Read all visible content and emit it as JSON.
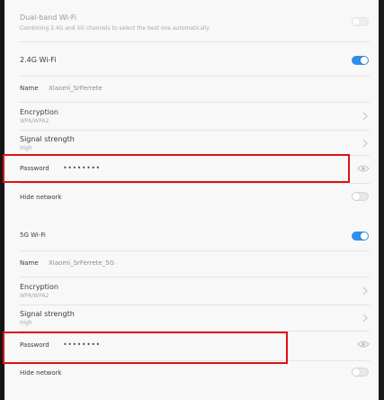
{
  "dual_band": {
    "title": "Dual-band Wi-Fi",
    "subtitle": "Combining 2.4G and 5G channels to select the best one automatically",
    "enabled": false
  },
  "band_24": {
    "title": "2.4G Wi-Fi",
    "enabled": true,
    "name_label": "Name",
    "name_value": "Xiaomi_SrFerrete",
    "encryption_label": "Encryption",
    "encryption_value": "WPA/WPA2",
    "signal_label": "Signal strength",
    "signal_value": "High",
    "password_label": "Password",
    "password_mask": "••••••••",
    "hide_label": "Hide network",
    "hide_enabled": false
  },
  "band_5": {
    "title": "5G Wi-Fi",
    "enabled": true,
    "name_label": "Name",
    "name_value": "Xiaomi_SrFerrete_5G",
    "encryption_label": "Encryption",
    "encryption_value": "WPA/WPA2",
    "signal_label": "Signal strength",
    "signal_value": "High",
    "password_label": "Password",
    "password_mask": "••••••••",
    "hide_label": "Hide network",
    "hide_enabled": false
  },
  "colors": {
    "accent": "#2f8fe8",
    "highlight": "#e01010"
  },
  "icons": {
    "chevron": "chevron-right-icon",
    "eye": "eye-icon"
  }
}
